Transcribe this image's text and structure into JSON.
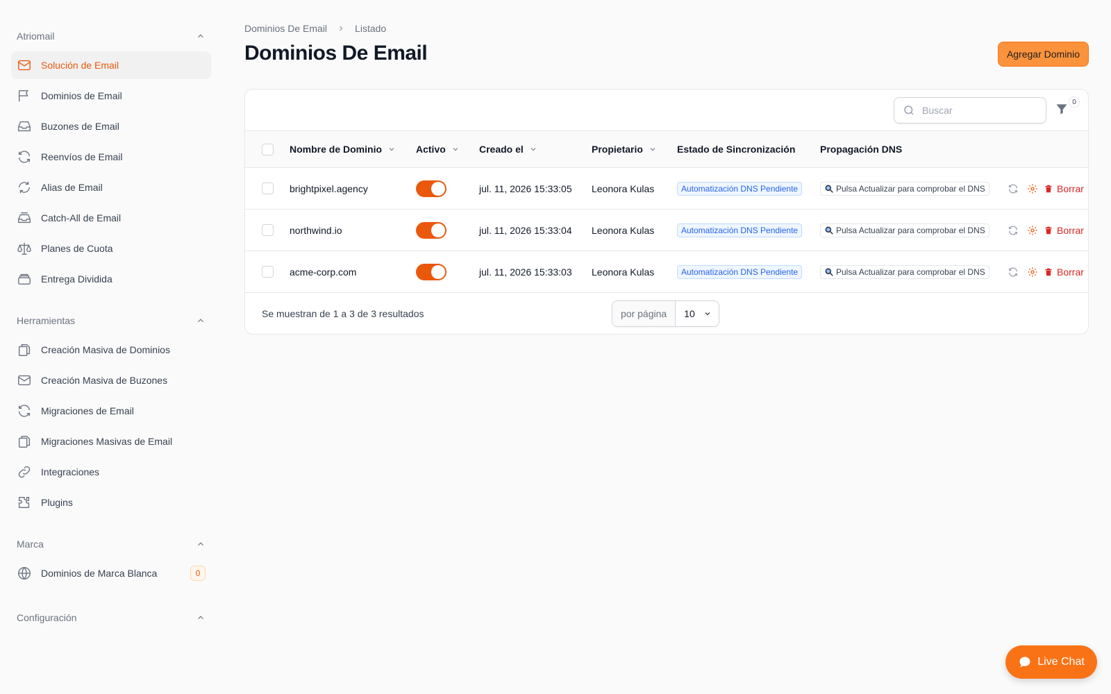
{
  "sidebar": {
    "groups": [
      {
        "title": "Atriomail",
        "items": [
          {
            "label": "Solución de Email",
            "icon": "envelope-icon"
          },
          {
            "label": "Dominios de Email",
            "icon": "flag-icon"
          },
          {
            "label": "Buzones de Email",
            "icon": "inbox-icon"
          },
          {
            "label": "Reenvíos de Email",
            "icon": "refresh-icon"
          },
          {
            "label": "Alias de Email",
            "icon": "arrows-icon"
          },
          {
            "label": "Catch-All de Email",
            "icon": "inbox-stack-icon"
          },
          {
            "label": "Planes de Cuota",
            "icon": "scale-icon"
          },
          {
            "label": "Entrega Dividida",
            "icon": "stack-icon"
          }
        ]
      },
      {
        "title": "Herramientas",
        "items": [
          {
            "label": "Creación Masiva de Dominios",
            "icon": "documents-icon"
          },
          {
            "label": "Creación Masiva de Buzones",
            "icon": "envelope-icon"
          },
          {
            "label": "Migraciones de Email",
            "icon": "refresh-icon"
          },
          {
            "label": "Migraciones Masivas de Email",
            "icon": "documents-icon"
          },
          {
            "label": "Integraciones",
            "icon": "link-icon"
          },
          {
            "label": "Plugins",
            "icon": "puzzle-icon"
          }
        ]
      },
      {
        "title": "Marca",
        "items": [
          {
            "label": "Dominios de Marca Blanca",
            "icon": "globe-icon",
            "badge": "0"
          }
        ]
      },
      {
        "title": "Configuración",
        "items": []
      }
    ]
  },
  "breadcrumb": {
    "parent": "Dominios De Email",
    "current": "Listado"
  },
  "page": {
    "title": "Dominios De Email",
    "add_button": "Agregar Dominio"
  },
  "toolbar": {
    "search_placeholder": "Buscar",
    "filter_count": "0"
  },
  "table": {
    "headers": {
      "name": "Nombre de Dominio",
      "active": "Activo",
      "created": "Creado el",
      "owner": "Propietario",
      "sync": "Estado de Sincronización",
      "dns": "Propagación DNS"
    },
    "rows": [
      {
        "name": "brightpixel.agency",
        "active": true,
        "created": "jul. 11, 2026 15:33:05",
        "owner": "Leonora Kulas",
        "sync": "Automatización DNS Pendiente",
        "dns": "Pulsa Actualizar para comprobar el DNS",
        "delete": "Borrar"
      },
      {
        "name": "northwind.io",
        "active": true,
        "created": "jul. 11, 2026 15:33:04",
        "owner": "Leonora Kulas",
        "sync": "Automatización DNS Pendiente",
        "dns": "Pulsa Actualizar para comprobar el DNS",
        "delete": "Borrar"
      },
      {
        "name": "acme-corp.com",
        "active": true,
        "created": "jul. 11, 2026 15:33:03",
        "owner": "Leonora Kulas",
        "sync": "Automatización DNS Pendiente",
        "dns": "Pulsa Actualizar para comprobar el DNS",
        "delete": "Borrar"
      }
    ]
  },
  "pagination": {
    "summary": "Se muestran de 1 a 3 de 3 resultados",
    "per_page_label": "por página",
    "per_page_value": "10"
  },
  "live_chat": {
    "label": "Live Chat"
  },
  "colors": {
    "accent": "#ea580c",
    "button": "#fb923c",
    "danger": "#dc2626",
    "info": "#2563eb"
  }
}
